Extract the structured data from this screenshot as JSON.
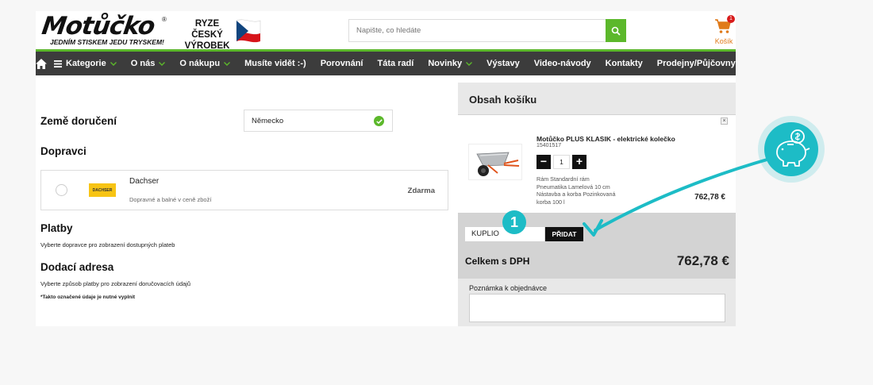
{
  "header": {
    "logo_main": "Motůčko",
    "logo_reg": "®",
    "logo_tagline": "JEDNÍM STISKEM JEDU TRYSKEM!",
    "made_line1": "RYZE ČESKÝ",
    "made_line2": "VÝROBEK",
    "search_placeholder": "Napište, co hledáte",
    "cart_label": "Košík",
    "cart_count": "1"
  },
  "nav": {
    "items": [
      {
        "label": "Kategorie",
        "chevron": true,
        "hamburger": true
      },
      {
        "label": "O nás",
        "chevron": true
      },
      {
        "label": "O nákupu",
        "chevron": true
      },
      {
        "label": "Musíte vidět :-)"
      },
      {
        "label": "Porovnání"
      },
      {
        "label": "Táta radí"
      },
      {
        "label": "Novinky",
        "chevron": true
      },
      {
        "label": "Výstavy"
      },
      {
        "label": "Video-návody"
      },
      {
        "label": "Kontakty"
      },
      {
        "label": "Prodejny/Půjčovny"
      }
    ]
  },
  "checkout": {
    "country_heading": "Země doručení",
    "country_value": "Německo",
    "carriers_heading": "Dopravci",
    "carrier": {
      "name": "Dachser",
      "logo_text": "DACHSER",
      "description": "Dopravné a balné v ceně zboží",
      "price": "Zdarma"
    },
    "payments_heading": "Platby",
    "payments_note": "Vyberte dopravce pro zobrazení dostupných plateb",
    "address_heading": "Dodací adresa",
    "address_note": "Vyberte způsob platby pro zobrazení doručovacích údajů",
    "required_note": "*Takto označené údaje je nutné vyplnit"
  },
  "summary": {
    "title": "Obsah košíku",
    "item": {
      "name": "Motůčko PLUS KLASIK - elektrické kolečko",
      "code": "15401517",
      "quantity": "1",
      "desc_lines": [
        "Rám Standardní rám",
        "Pneumatika Lamelová 10 cm",
        "Nástavba a korba Pozinkovaná",
        "korba 100 l"
      ],
      "price": "762,78 €",
      "remove": "×"
    },
    "coupon_value": "KUPLIO",
    "coupon_button": "PŘIDAT",
    "total_label": "Celkem s DPH",
    "total_value": "762,78 €",
    "note_label": "Poznámka k objednávce"
  },
  "overlay": {
    "step_number": "1",
    "accent": "#1dbcc6"
  },
  "colors": {
    "brand_green": "#5cb82b",
    "nav_bg": "#3c3c3c",
    "cart_orange": "#e07a1a",
    "badge_red": "#d81b1b"
  }
}
